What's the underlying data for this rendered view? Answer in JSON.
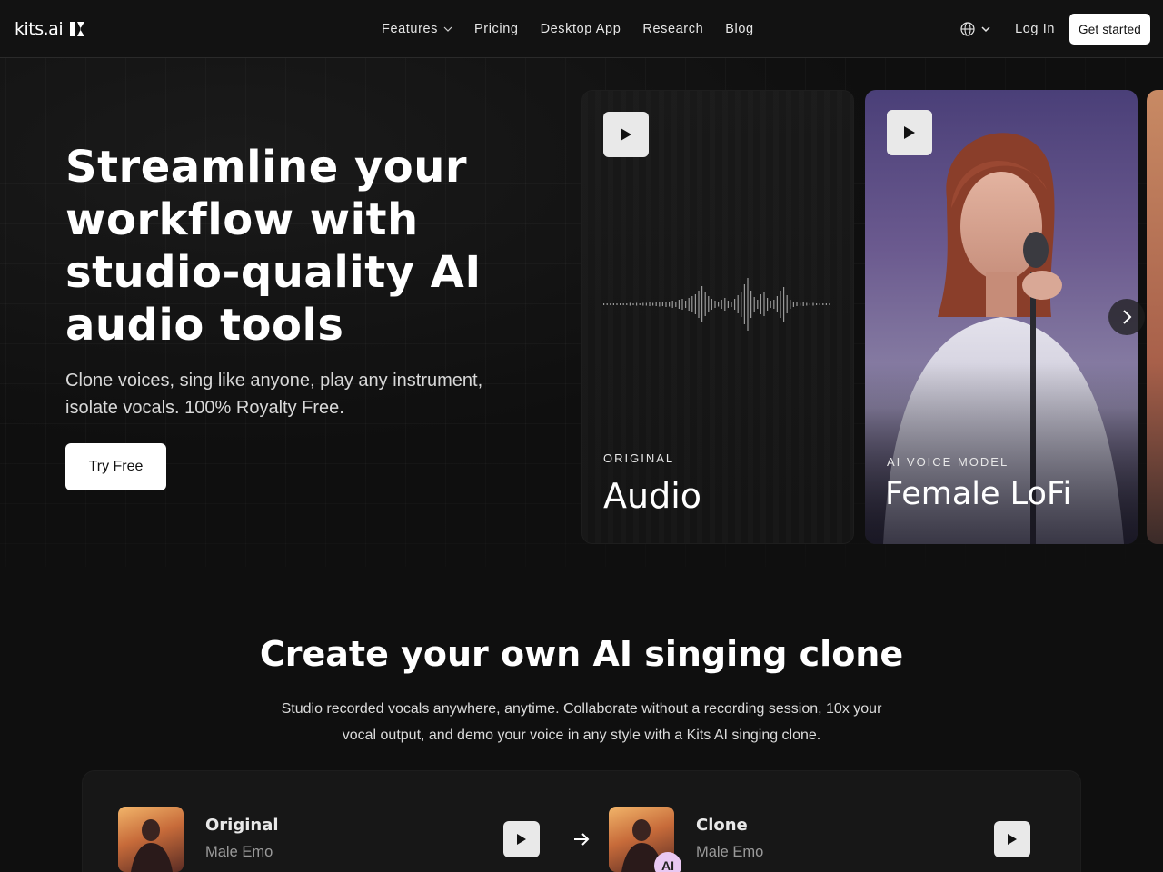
{
  "nav": {
    "logo_text": "kits.ai",
    "links": [
      {
        "label": "Features",
        "has_dropdown": true
      },
      {
        "label": "Pricing"
      },
      {
        "label": "Desktop App"
      },
      {
        "label": "Research"
      },
      {
        "label": "Blog"
      }
    ],
    "language_icon": "globe-icon",
    "login_label": "Log In",
    "get_started_label": "Get started"
  },
  "hero": {
    "title": "Streamline your workflow with studio-quality AI audio tools",
    "subtitle": "Clone voices, sing like anyone, play any instrument, isolate vocals. 100% Royalty Free.",
    "cta_label": "Try Free"
  },
  "cards": [
    {
      "label": "ORIGINAL",
      "name": "Audio",
      "icon": "play-icon"
    },
    {
      "label": "AI VOICE MODEL",
      "name": "Female LoFi",
      "icon": "play-icon"
    }
  ],
  "carousel": {
    "next_icon": "chevron-right-icon"
  },
  "clone_section": {
    "title": "Create your own AI singing clone",
    "subtitle": "Studio recorded vocals anywhere, anytime. Collaborate without a recording session, 10x your vocal output, and demo your voice in any style with a Kits AI singing clone.",
    "original": {
      "title": "Original",
      "sub": "Male Emo"
    },
    "clone": {
      "title": "Clone",
      "sub": "Male Emo",
      "badge": "AI"
    },
    "arrow_icon": "arrow-right-icon"
  },
  "colors": {
    "background": "#0f0f0f",
    "nav_background": "#121212",
    "button_light": "#ffffff",
    "ai_badge": "#e9c8f2"
  }
}
